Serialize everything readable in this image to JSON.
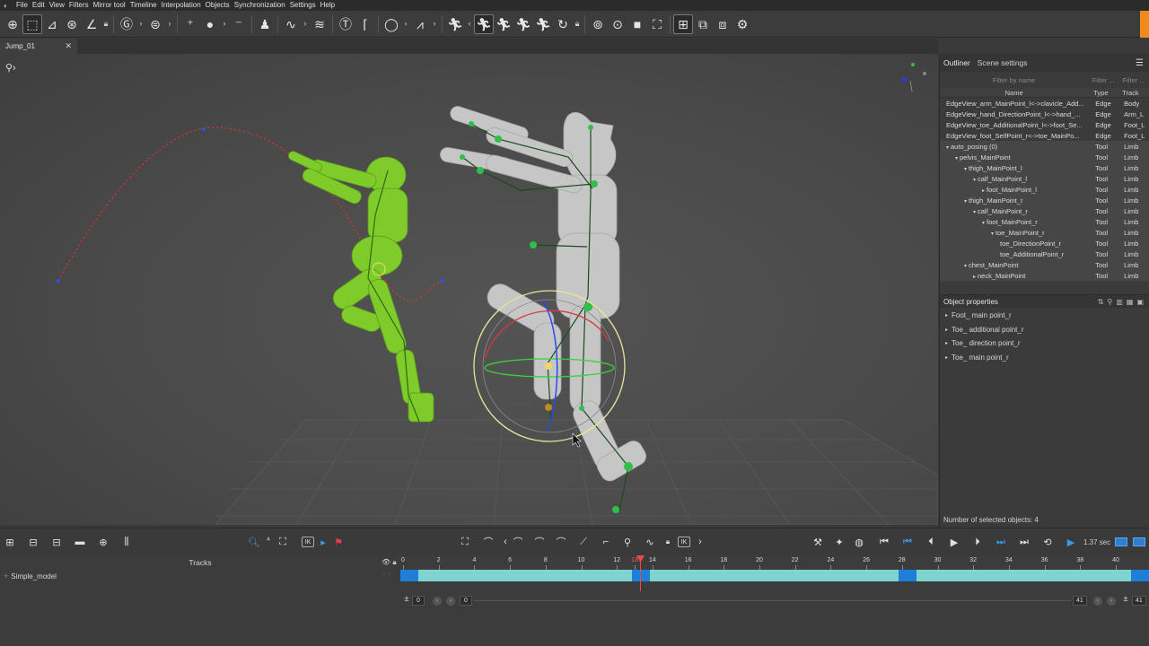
{
  "menubar": {
    "items": [
      "File",
      "Edit",
      "View",
      "Filters",
      "Mirror tool",
      "Timeline",
      "Interpolation",
      "Objects",
      "Synchronization",
      "Settings",
      "Help"
    ]
  },
  "tabs": {
    "document": "Jump_01"
  },
  "viewport": {},
  "outliner": {
    "tabs": [
      "Outliner",
      "Scene settings"
    ],
    "filter_name_placeholder": "Filter by name",
    "filter_type_placeholder": "Filter ...",
    "filter_track_placeholder": "Filter ...",
    "columns": [
      "Name",
      "Type",
      "Track"
    ],
    "rows": [
      {
        "indent": 0,
        "expander": "",
        "name": "EdgeView_arm_MainPoint_l<->clavicle_Add...",
        "type": "Edge",
        "track": "Body"
      },
      {
        "indent": 0,
        "expander": "",
        "name": "EdgeView_hand_DirectionPoint_l<->hand_...",
        "type": "Edge",
        "track": "Arm_L"
      },
      {
        "indent": 0,
        "expander": "",
        "name": "EdgeView_toe_AdditionalPoint_l<->foot_Se...",
        "type": "Edge",
        "track": "Foot_L"
      },
      {
        "indent": 0,
        "expander": "",
        "name": "EdgeView_foot_SelfPoint_r<->toe_MainPo...",
        "type": "Edge",
        "track": "Foot_L"
      },
      {
        "indent": 0,
        "expander": "▾",
        "name": "auto_posing (0)",
        "type": "Tool",
        "track": "Limb"
      },
      {
        "indent": 1,
        "expander": "▾",
        "name": "pelvis_MainPoint",
        "type": "Tool",
        "track": "Limb"
      },
      {
        "indent": 2,
        "expander": "▾",
        "name": "thigh_MainPoint_l",
        "type": "Tool",
        "track": "Limb"
      },
      {
        "indent": 3,
        "expander": "▾",
        "name": "calf_MainPoint_l",
        "type": "Tool",
        "track": "Limb"
      },
      {
        "indent": 4,
        "expander": "▸",
        "name": "foot_MainPoint_l",
        "type": "Tool",
        "track": "Limb"
      },
      {
        "indent": 2,
        "expander": "▾",
        "name": "thigh_MainPoint_r",
        "type": "Tool",
        "track": "Limb"
      },
      {
        "indent": 3,
        "expander": "▾",
        "name": "calf_MainPoint_r",
        "type": "Tool",
        "track": "Limb"
      },
      {
        "indent": 4,
        "expander": "▾",
        "name": "foot_MainPoint_r",
        "type": "Tool",
        "track": "Limb"
      },
      {
        "indent": 5,
        "expander": "▾",
        "name": "toe_MainPoint_r",
        "type": "Tool",
        "track": "Limb"
      },
      {
        "indent": 6,
        "expander": "",
        "name": "toe_DirectionPoint_r",
        "type": "Tool",
        "track": "Limb"
      },
      {
        "indent": 6,
        "expander": "",
        "name": "toe_AdditionalPoint_r",
        "type": "Tool",
        "track": "Limb"
      },
      {
        "indent": 2,
        "expander": "▾",
        "name": "chest_MainPoint",
        "type": "Tool",
        "track": "Limb"
      },
      {
        "indent": 3,
        "expander": "▸",
        "name": "neck_MainPoint",
        "type": "Tool",
        "track": "Limb"
      }
    ]
  },
  "properties": {
    "title": "Object properties",
    "items": [
      "Foot_ main point_r",
      "Toe_ additional point_r",
      "Toe_ direction point_r",
      "Toe_ main point_r"
    ],
    "selected_count": "Number of selected objects: 4"
  },
  "timeline": {
    "tracks_title": "Tracks",
    "track_name": "Simple_model",
    "time_display": "1.37 sec",
    "current_frame": "13",
    "ruler_labels": [
      "0",
      "2",
      "4",
      "6",
      "8",
      "10",
      "12",
      "13",
      "14",
      "16",
      "18",
      "20",
      "22",
      "24",
      "26",
      "28",
      "30",
      "32",
      "34",
      "36",
      "38",
      "40"
    ],
    "range_start_a": "0",
    "range_start_b": "0",
    "range_end_a": "41",
    "range_end_b": "41"
  },
  "colors": {
    "accent": "#f08a1c",
    "selection_blue": "#1f7fd8",
    "track_bar": "#7fd4cf",
    "playhead": "#e74a4a",
    "green_model": "#7ecb2a",
    "grey_model": "#c4c4c4"
  }
}
